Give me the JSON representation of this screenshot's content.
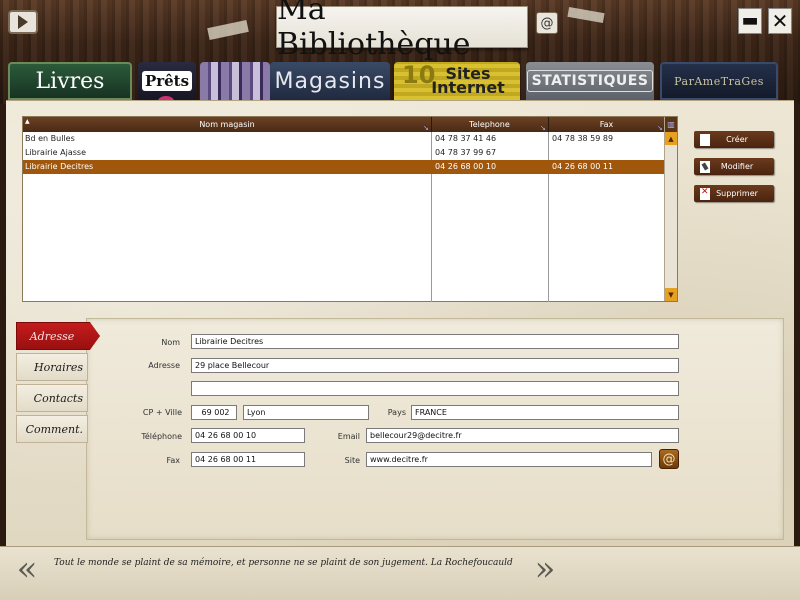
{
  "app": {
    "title": "Ma Bibliothèque",
    "at_symbol": "@",
    "minimize": "▬",
    "close": "✕"
  },
  "tabs": [
    {
      "label": "Livres"
    },
    {
      "label": "Prêts"
    },
    {
      "label": ""
    },
    {
      "label": "Magasins"
    },
    {
      "label": "Sites Internet",
      "prefix": "10"
    },
    {
      "label": "STATISTIQUES"
    },
    {
      "label": "ParAmeTraGes"
    }
  ],
  "grid": {
    "headers": [
      "Nom magasin",
      "Telephone",
      "Fax"
    ],
    "rows": [
      {
        "name": "Bd en Bulles",
        "tel": "04 78 37 41 46",
        "fax": "04 78 38 59 89"
      },
      {
        "name": "Librairie Ajasse",
        "tel": "04 78 37 99 67",
        "fax": ""
      },
      {
        "name": "Librairie Decitres",
        "tel": "04 26 68 00 10",
        "fax": "04 26 68 00 11"
      }
    ],
    "selected_index": 2
  },
  "actions": {
    "create": "Créer",
    "modify": "Modifier",
    "delete": "Supprimer"
  },
  "side_tabs": [
    "Adresse",
    "Horaires",
    "Contacts",
    "Comment."
  ],
  "form": {
    "labels": {
      "nom": "Nom",
      "adresse": "Adresse",
      "cp_ville": "CP + Ville",
      "pays": "Pays",
      "telephone": "Téléphone",
      "email": "Email",
      "fax": "Fax",
      "site": "Site"
    },
    "values": {
      "nom": "Librairie Decitres",
      "adresse1": "29 place Bellecour",
      "adresse2": "",
      "cp": "69 002",
      "ville": "Lyon",
      "pays": "FRANCE",
      "telephone": "04 26 68 00 10",
      "email": "bellecour29@decitre.fr",
      "fax": "04 26 68 00 11",
      "site": "www.decitre.fr"
    },
    "site_button": "@"
  },
  "footer": {
    "prev": "«",
    "next": "»",
    "quote": "Tout le monde se plaint de sa mémoire, et personne ne se plaint de son jugement.  La Rochefoucauld"
  },
  "colors": {
    "header_brown": "#4a2a14",
    "selected_row": "#a0570c",
    "active_tab_red": "#b81818",
    "button_brown": "#5a2e14",
    "scroll_orange": "#e8a020"
  }
}
